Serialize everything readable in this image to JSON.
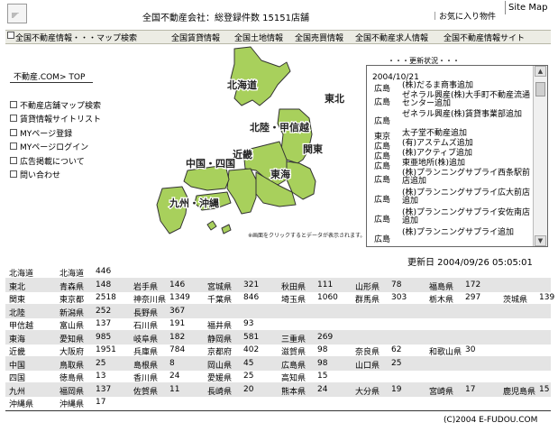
{
  "header": {
    "site_count": "全国不動産会社：総登録件数 15151店舗",
    "favorites": "｜お気に入り物件",
    "sitemap": "Site Map"
  },
  "nav": [
    "全国不動産情報・・・マップ検索",
    "全国賃貸情報",
    "全国土地情報",
    "全国売買情報",
    "全国不動産求人情報",
    "全国不動産情報サイト"
  ],
  "left": {
    "top_link": "不動産.COM> TOP",
    "menu": [
      "不動産店舗マップ検索",
      "賃貸情報サイトリスト",
      "MYページ登録",
      "MYページログイン",
      "広告掲載について",
      "問い合わせ"
    ]
  },
  "map": {
    "regions": [
      "北海道",
      "東北",
      "北陸・甲信越",
      "関東",
      "東海",
      "近畿",
      "中国・四国",
      "九州・沖縄"
    ],
    "caption": "※画面をクリックするとデータが表示されます。",
    "land_color": "#a8d05c",
    "edge_color": "#333333"
  },
  "updates": {
    "title": "・・・更新状況・・・",
    "date": "2004/10/21",
    "items": [
      {
        "pref": "広島",
        "text": "(株)だるま商事追加"
      },
      {
        "pref": "広島",
        "text": "ゼネラル興産(株)大手町不動産流通センター追加"
      },
      {
        "pref": "広島",
        "text": "ゼネラル興産(株)賃貸事業部追加"
      },
      {
        "pref": "東京",
        "text": "太子堂不動産追加"
      },
      {
        "pref": "広島",
        "text": "(有)アステムズ追加"
      },
      {
        "pref": "広島",
        "text": "(株)アクティブ追加"
      },
      {
        "pref": "広島",
        "text": "東亜地所(株)追加"
      },
      {
        "pref": "広島",
        "text": "(株)プランニングサプライ西条駅前店追加"
      },
      {
        "pref": "広島",
        "text": "(株)プランニングサプライ広大前店追加"
      },
      {
        "pref": "広島",
        "text": "(株)プランニングサプライ安佐南店追加"
      },
      {
        "pref": "広島",
        "text": "(株)プランニングサプライ追加"
      }
    ]
  },
  "updated": "更新日 2004/09/26 05:05:01",
  "table": [
    {
      "region": "北海道",
      "prefs": [
        [
          "北海道",
          "446"
        ]
      ]
    },
    {
      "region": "東北",
      "prefs": [
        [
          "青森県",
          "148"
        ],
        [
          "岩手県",
          "146"
        ],
        [
          "宮城県",
          "321"
        ],
        [
          "秋田県",
          "111"
        ],
        [
          "山形県",
          "78"
        ],
        [
          "福島県",
          "172"
        ]
      ]
    },
    {
      "region": "関東",
      "prefs": [
        [
          "東京都",
          "2518"
        ],
        [
          "神奈川県",
          "1349"
        ],
        [
          "千葉県",
          "846"
        ],
        [
          "埼玉県",
          "1060"
        ],
        [
          "群馬県",
          "303"
        ],
        [
          "栃木県",
          "297"
        ],
        [
          "茨城県",
          "139"
        ]
      ]
    },
    {
      "region": "北陸",
      "prefs": [
        [
          "新潟県",
          "252"
        ],
        [
          "長野県",
          "367"
        ]
      ]
    },
    {
      "region": "甲信越",
      "prefs": [
        [
          "富山県",
          "137"
        ],
        [
          "石川県",
          "191"
        ],
        [
          "福井県",
          "93"
        ]
      ]
    },
    {
      "region": "東海",
      "prefs": [
        [
          "愛知県",
          "985"
        ],
        [
          "岐阜県",
          "182"
        ],
        [
          "静岡県",
          "581"
        ],
        [
          "三重県",
          "269"
        ]
      ]
    },
    {
      "region": "近畿",
      "prefs": [
        [
          "大阪府",
          "1951"
        ],
        [
          "兵庫県",
          "784"
        ],
        [
          "京都府",
          "402"
        ],
        [
          "滋賀県",
          "98"
        ],
        [
          "奈良県",
          "62"
        ],
        [
          "和歌山県",
          "30"
        ]
      ]
    },
    {
      "region": "中国",
      "prefs": [
        [
          "鳥取県",
          "25"
        ],
        [
          "島根県",
          "8"
        ],
        [
          "岡山県",
          "45"
        ],
        [
          "広島県",
          "98"
        ],
        [
          "山口県",
          "25"
        ]
      ]
    },
    {
      "region": "四国",
      "prefs": [
        [
          "徳島県",
          "13"
        ],
        [
          "香川県",
          "24"
        ],
        [
          "愛媛県",
          "25"
        ],
        [
          "高知県",
          "15"
        ]
      ]
    },
    {
      "region": "九州",
      "prefs": [
        [
          "福岡県",
          "137"
        ],
        [
          "佐賀県",
          "11"
        ],
        [
          "長崎県",
          "20"
        ],
        [
          "熊本県",
          "24"
        ],
        [
          "大分県",
          "19"
        ],
        [
          "宮崎県",
          "17"
        ],
        [
          "鹿児島県",
          "15"
        ]
      ]
    },
    {
      "region": "沖縄県",
      "prefs": [
        [
          "沖縄県",
          "17"
        ]
      ]
    }
  ],
  "copyright": "(C)2004 E-FUDOU.COM"
}
